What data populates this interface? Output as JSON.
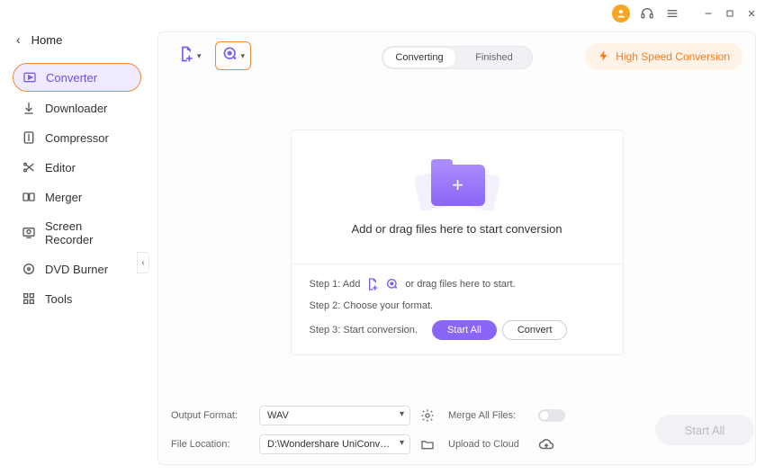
{
  "titlebar": {
    "icons": {
      "user": "user-icon",
      "headset": "headset-icon",
      "menu": "menu-icon"
    }
  },
  "sidebar": {
    "home": "Home",
    "items": [
      {
        "label": "Converter",
        "icon": "converter"
      },
      {
        "label": "Downloader",
        "icon": "download"
      },
      {
        "label": "Compressor",
        "icon": "compress"
      },
      {
        "label": "Editor",
        "icon": "scissors"
      },
      {
        "label": "Merger",
        "icon": "merge"
      },
      {
        "label": "Screen Recorder",
        "icon": "screenrec"
      },
      {
        "label": "DVD Burner",
        "icon": "disc"
      },
      {
        "label": "Tools",
        "icon": "tools"
      }
    ]
  },
  "toolbar": {
    "tabs": {
      "converting": "Converting",
      "finished": "Finished"
    },
    "highspeed": "High Speed Conversion"
  },
  "drop": {
    "title": "Add or drag files here to start conversion",
    "step1_prefix": "Step 1: Add",
    "step1_suffix": "or drag files here to start.",
    "step2": "Step 2: Choose your format.",
    "step3": "Step 3: Start conversion.",
    "start_all": "Start All",
    "convert": "Convert"
  },
  "bottom": {
    "output_format_label": "Output Format:",
    "output_format_value": "WAV",
    "merge_label": "Merge All Files:",
    "file_location_label": "File Location:",
    "file_location_value": "D:\\Wondershare UniConverter 1",
    "upload_label": "Upload to Cloud",
    "start_all": "Start All"
  },
  "colors": {
    "accent": "#8a66f6",
    "orange": "#ff7a1a"
  }
}
